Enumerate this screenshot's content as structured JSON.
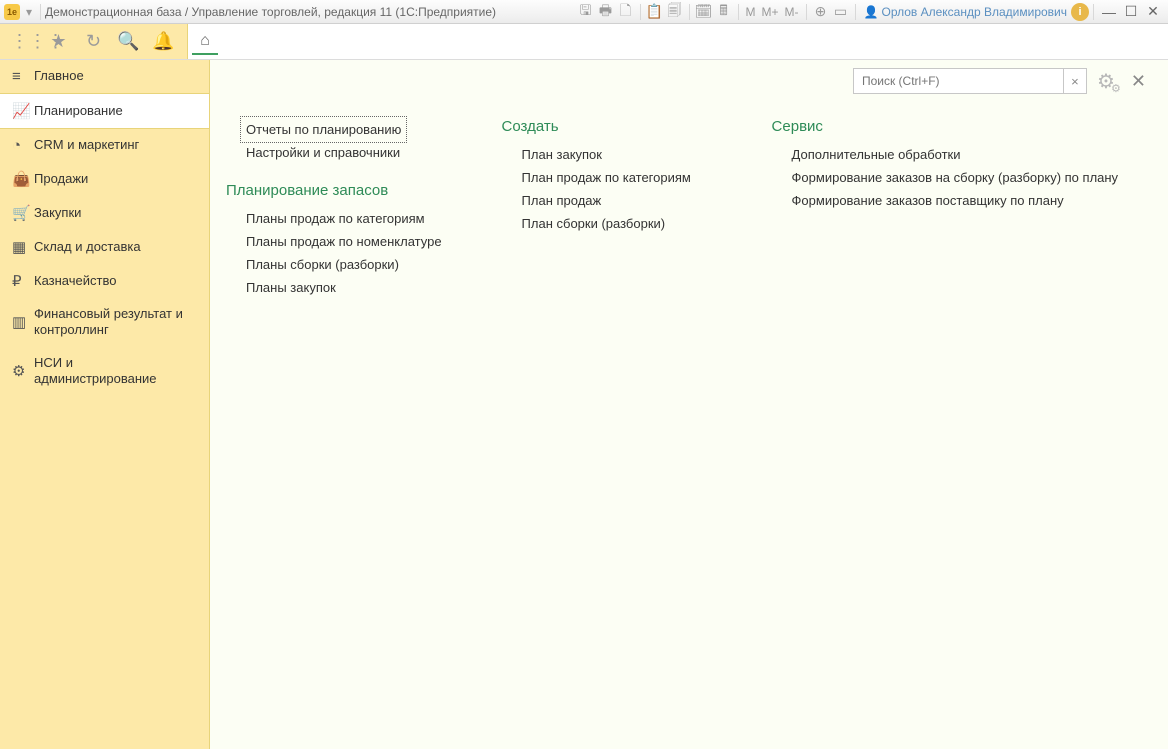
{
  "titlebar": {
    "app_badge": "1e",
    "title": "Демонстрационная база / Управление торговлей, редакция 11  (1С:Предприятие)",
    "m_items": [
      "M",
      "M+",
      "M-"
    ],
    "user_name": "Орлов Александр Владимирович",
    "info_badge": "i"
  },
  "sidebar": {
    "items": [
      {
        "icon": "menu",
        "label": "Главное"
      },
      {
        "icon": "chart-growth",
        "label": "Планирование"
      },
      {
        "icon": "pie",
        "label": "CRM и маркетинг"
      },
      {
        "icon": "bag",
        "label": "Продажи"
      },
      {
        "icon": "cart",
        "label": "Закупки"
      },
      {
        "icon": "boxes",
        "label": "Склад и доставка"
      },
      {
        "icon": "ruble",
        "label": "Казначейство"
      },
      {
        "icon": "bars",
        "label": "Финансовый результат и контроллинг"
      },
      {
        "icon": "gear",
        "label": "НСИ и администрирование"
      }
    ],
    "active_index": 1
  },
  "search": {
    "placeholder": "Поиск (Ctrl+F)"
  },
  "sections": {
    "col1": {
      "top_links": [
        "Отчеты по планированию",
        "Настройки и справочники"
      ],
      "group_title": "Планирование запасов",
      "group_links": [
        "Планы продаж по категориям",
        "Планы продаж по номенклатуре",
        "Планы сборки (разборки)",
        "Планы закупок"
      ]
    },
    "col2": {
      "title": "Создать",
      "links": [
        "План закупок",
        "План продаж по категориям",
        "План продаж",
        "План сборки (разборки)"
      ]
    },
    "col3": {
      "title": "Сервис",
      "links": [
        "Дополнительные обработки",
        "Формирование заказов на сборку (разборку) по плану",
        "Формирование заказов поставщику по плану"
      ]
    }
  }
}
